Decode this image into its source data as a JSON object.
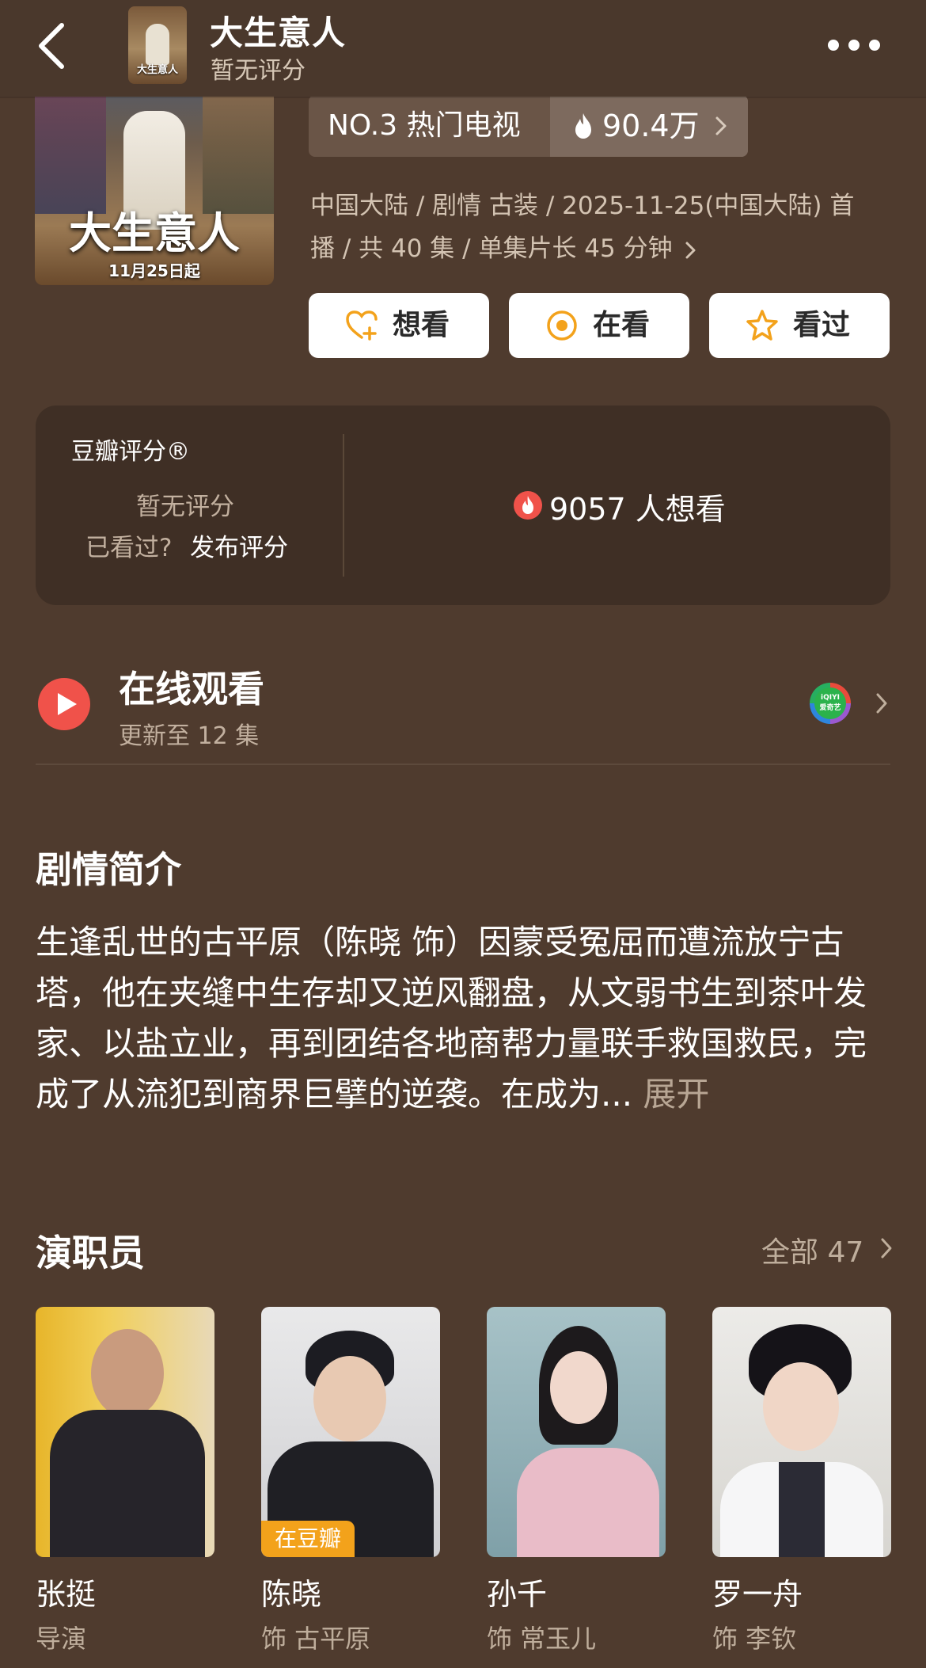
{
  "header": {
    "title": "大生意人",
    "subtitle": "暂无评分"
  },
  "poster": {
    "title": "大生意人",
    "date": "11月25日起"
  },
  "rank": {
    "label": "NO.3 热门电视",
    "heat": "90.4万"
  },
  "meta": {
    "line1": "中国大陆 / 剧情 古装 / 2025-11-25(中国大陆) 首",
    "line2": "播 / 共 40 集 / 单集片长 45 分钟"
  },
  "actions": {
    "want": "想看",
    "watching": "在看",
    "watched": "看过"
  },
  "rating": {
    "title": "豆瓣评分®",
    "status": "暂无评分",
    "watched_prompt": "已看过?",
    "publish_label": "发布评分",
    "want_count": "9057 人想看"
  },
  "online": {
    "title": "在线观看",
    "update": "更新至 12 集",
    "platform_short": "iQIYI",
    "platform_name": "爱奇艺"
  },
  "synopsis": {
    "heading": "剧情简介",
    "text": "生逢乱世的古平原（陈晓 饰）因蒙受冤屈而遭流放宁古塔，他在夹缝中生存却又逆风翻盘，从文弱书生到茶叶发家、以盐立业，再到团结各地商帮力量联手救国救民，完成了从流犯到商界巨擘的逆袭。在成为...",
    "expand": "展开"
  },
  "cast": {
    "heading": "演职员",
    "all_label": "全部 47",
    "members": [
      {
        "name": "张挺",
        "role": "导演",
        "badge": ""
      },
      {
        "name": "陈晓",
        "role": "饰 古平原",
        "badge": "在豆瓣"
      },
      {
        "name": "孙千",
        "role": "饰 常玉儿",
        "badge": ""
      },
      {
        "name": "罗一舟",
        "role": "饰 李钦",
        "badge": ""
      }
    ]
  },
  "colors": {
    "background": "#4f3b2e",
    "card": "#3f2f25",
    "accent_orange": "#f3a21b",
    "play_red": "#f0524a"
  }
}
